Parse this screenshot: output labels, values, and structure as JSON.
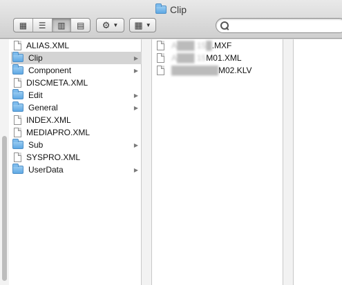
{
  "window": {
    "title": "Clip"
  },
  "toolbar": {
    "view_buttons": [
      {
        "name": "icon-view",
        "glyph": "▦"
      },
      {
        "name": "list-view",
        "glyph": "☰"
      },
      {
        "name": "column-view",
        "glyph": "▥"
      },
      {
        "name": "coverflow-view",
        "glyph": "▤"
      }
    ],
    "gear_glyph": "⚙",
    "arrange_glyph": "▦",
    "caret_glyph": "▼",
    "search": {
      "value": "",
      "placeholder": ""
    }
  },
  "column1": {
    "items": [
      {
        "label": "ALIAS.XML",
        "type": "file"
      },
      {
        "label": "Clip",
        "type": "folder",
        "selected": true
      },
      {
        "label": "Component",
        "type": "folder"
      },
      {
        "label": "DISCMETA.XML",
        "type": "file"
      },
      {
        "label": "Edit",
        "type": "folder"
      },
      {
        "label": "General",
        "type": "folder"
      },
      {
        "label": "INDEX.XML",
        "type": "file"
      },
      {
        "label": "MEDIAPRO.XML",
        "type": "file"
      },
      {
        "label": "Sub",
        "type": "folder"
      },
      {
        "label": "SYSPRO.XML",
        "type": "file"
      },
      {
        "label": "UserData",
        "type": "folder"
      }
    ],
    "arrow_glyph": "▶"
  },
  "column2": {
    "items": [
      {
        "hidden_part": "A███ 15█",
        "label": ".MXF"
      },
      {
        "hidden_part": "A███ 15",
        "label": "M01.XML"
      },
      {
        "hidden_part": "████████",
        "label": "M02.KLV"
      }
    ]
  }
}
